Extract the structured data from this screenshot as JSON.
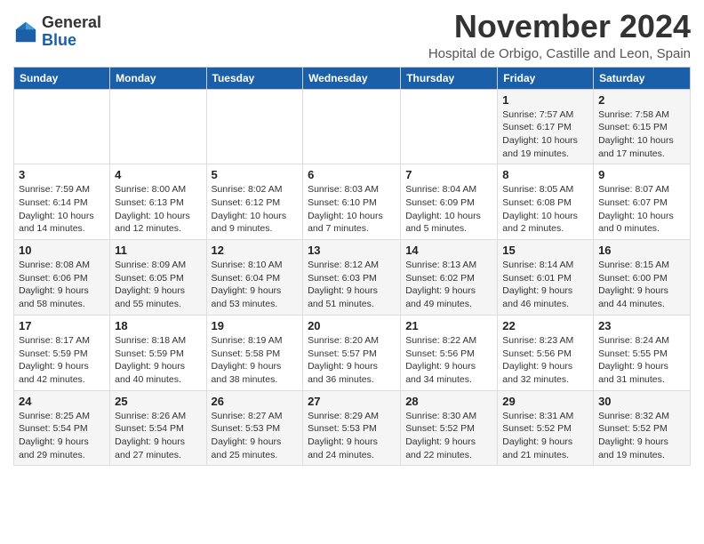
{
  "header": {
    "logo_general": "General",
    "logo_blue": "Blue",
    "month_title": "November 2024",
    "location": "Hospital de Orbigo, Castille and Leon, Spain"
  },
  "weekdays": [
    "Sunday",
    "Monday",
    "Tuesday",
    "Wednesday",
    "Thursday",
    "Friday",
    "Saturday"
  ],
  "weeks": [
    [
      {
        "day": "",
        "info": ""
      },
      {
        "day": "",
        "info": ""
      },
      {
        "day": "",
        "info": ""
      },
      {
        "day": "",
        "info": ""
      },
      {
        "day": "",
        "info": ""
      },
      {
        "day": "1",
        "info": "Sunrise: 7:57 AM\nSunset: 6:17 PM\nDaylight: 10 hours and 19 minutes."
      },
      {
        "day": "2",
        "info": "Sunrise: 7:58 AM\nSunset: 6:15 PM\nDaylight: 10 hours and 17 minutes."
      }
    ],
    [
      {
        "day": "3",
        "info": "Sunrise: 7:59 AM\nSunset: 6:14 PM\nDaylight: 10 hours and 14 minutes."
      },
      {
        "day": "4",
        "info": "Sunrise: 8:00 AM\nSunset: 6:13 PM\nDaylight: 10 hours and 12 minutes."
      },
      {
        "day": "5",
        "info": "Sunrise: 8:02 AM\nSunset: 6:12 PM\nDaylight: 10 hours and 9 minutes."
      },
      {
        "day": "6",
        "info": "Sunrise: 8:03 AM\nSunset: 6:10 PM\nDaylight: 10 hours and 7 minutes."
      },
      {
        "day": "7",
        "info": "Sunrise: 8:04 AM\nSunset: 6:09 PM\nDaylight: 10 hours and 5 minutes."
      },
      {
        "day": "8",
        "info": "Sunrise: 8:05 AM\nSunset: 6:08 PM\nDaylight: 10 hours and 2 minutes."
      },
      {
        "day": "9",
        "info": "Sunrise: 8:07 AM\nSunset: 6:07 PM\nDaylight: 10 hours and 0 minutes."
      }
    ],
    [
      {
        "day": "10",
        "info": "Sunrise: 8:08 AM\nSunset: 6:06 PM\nDaylight: 9 hours and 58 minutes."
      },
      {
        "day": "11",
        "info": "Sunrise: 8:09 AM\nSunset: 6:05 PM\nDaylight: 9 hours and 55 minutes."
      },
      {
        "day": "12",
        "info": "Sunrise: 8:10 AM\nSunset: 6:04 PM\nDaylight: 9 hours and 53 minutes."
      },
      {
        "day": "13",
        "info": "Sunrise: 8:12 AM\nSunset: 6:03 PM\nDaylight: 9 hours and 51 minutes."
      },
      {
        "day": "14",
        "info": "Sunrise: 8:13 AM\nSunset: 6:02 PM\nDaylight: 9 hours and 49 minutes."
      },
      {
        "day": "15",
        "info": "Sunrise: 8:14 AM\nSunset: 6:01 PM\nDaylight: 9 hours and 46 minutes."
      },
      {
        "day": "16",
        "info": "Sunrise: 8:15 AM\nSunset: 6:00 PM\nDaylight: 9 hours and 44 minutes."
      }
    ],
    [
      {
        "day": "17",
        "info": "Sunrise: 8:17 AM\nSunset: 5:59 PM\nDaylight: 9 hours and 42 minutes."
      },
      {
        "day": "18",
        "info": "Sunrise: 8:18 AM\nSunset: 5:59 PM\nDaylight: 9 hours and 40 minutes."
      },
      {
        "day": "19",
        "info": "Sunrise: 8:19 AM\nSunset: 5:58 PM\nDaylight: 9 hours and 38 minutes."
      },
      {
        "day": "20",
        "info": "Sunrise: 8:20 AM\nSunset: 5:57 PM\nDaylight: 9 hours and 36 minutes."
      },
      {
        "day": "21",
        "info": "Sunrise: 8:22 AM\nSunset: 5:56 PM\nDaylight: 9 hours and 34 minutes."
      },
      {
        "day": "22",
        "info": "Sunrise: 8:23 AM\nSunset: 5:56 PM\nDaylight: 9 hours and 32 minutes."
      },
      {
        "day": "23",
        "info": "Sunrise: 8:24 AM\nSunset: 5:55 PM\nDaylight: 9 hours and 31 minutes."
      }
    ],
    [
      {
        "day": "24",
        "info": "Sunrise: 8:25 AM\nSunset: 5:54 PM\nDaylight: 9 hours and 29 minutes."
      },
      {
        "day": "25",
        "info": "Sunrise: 8:26 AM\nSunset: 5:54 PM\nDaylight: 9 hours and 27 minutes."
      },
      {
        "day": "26",
        "info": "Sunrise: 8:27 AM\nSunset: 5:53 PM\nDaylight: 9 hours and 25 minutes."
      },
      {
        "day": "27",
        "info": "Sunrise: 8:29 AM\nSunset: 5:53 PM\nDaylight: 9 hours and 24 minutes."
      },
      {
        "day": "28",
        "info": "Sunrise: 8:30 AM\nSunset: 5:52 PM\nDaylight: 9 hours and 22 minutes."
      },
      {
        "day": "29",
        "info": "Sunrise: 8:31 AM\nSunset: 5:52 PM\nDaylight: 9 hours and 21 minutes."
      },
      {
        "day": "30",
        "info": "Sunrise: 8:32 AM\nSunset: 5:52 PM\nDaylight: 9 hours and 19 minutes."
      }
    ]
  ]
}
